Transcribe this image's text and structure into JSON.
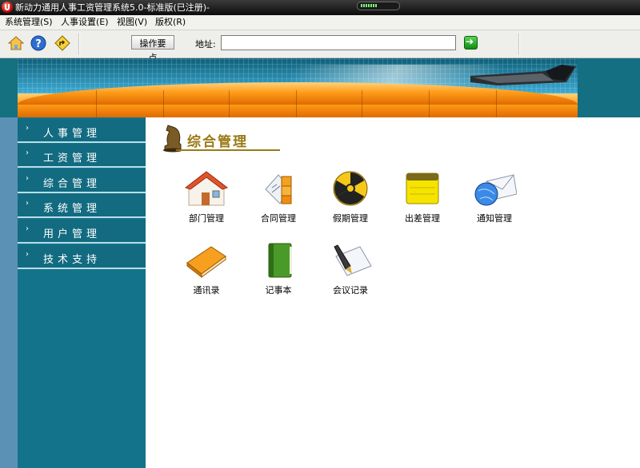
{
  "window": {
    "title": "新动力通用人事工资管理系统5.0-标准版(已注册)-"
  },
  "menubar": {
    "items": [
      "系统管理(S)",
      "人事设置(E)",
      "视图(V)",
      "版权(R)"
    ]
  },
  "toolbar": {
    "icons": [
      "home-icon",
      "help-icon",
      "back-icon"
    ],
    "ops_label": "操作要点",
    "address_label": "地址:",
    "address_value": ""
  },
  "sidebar": {
    "items": [
      {
        "label": "人事管理"
      },
      {
        "label": "工资管理"
      },
      {
        "label": "综合管理"
      },
      {
        "label": "系统管理"
      },
      {
        "label": "用户管理"
      },
      {
        "label": "技术支持"
      }
    ]
  },
  "content": {
    "section_title": "综合管理",
    "tiles": [
      {
        "label": "部门管理",
        "icon": "house-icon"
      },
      {
        "label": "合同管理",
        "icon": "contract-icon"
      },
      {
        "label": "假期管理",
        "icon": "radiation-icon"
      },
      {
        "label": "出差管理",
        "icon": "notepad-icon"
      },
      {
        "label": "通知管理",
        "icon": "email-globe-icon"
      },
      {
        "label": "通讯录",
        "icon": "address-book-icon"
      },
      {
        "label": "记事本",
        "icon": "notebook-icon"
      },
      {
        "label": "会议记录",
        "icon": "pen-icon"
      }
    ]
  },
  "colors": {
    "sidebar_bg": "#13738a",
    "banner_orange": "#ff9c1a",
    "section_title": "#9a7a16"
  }
}
